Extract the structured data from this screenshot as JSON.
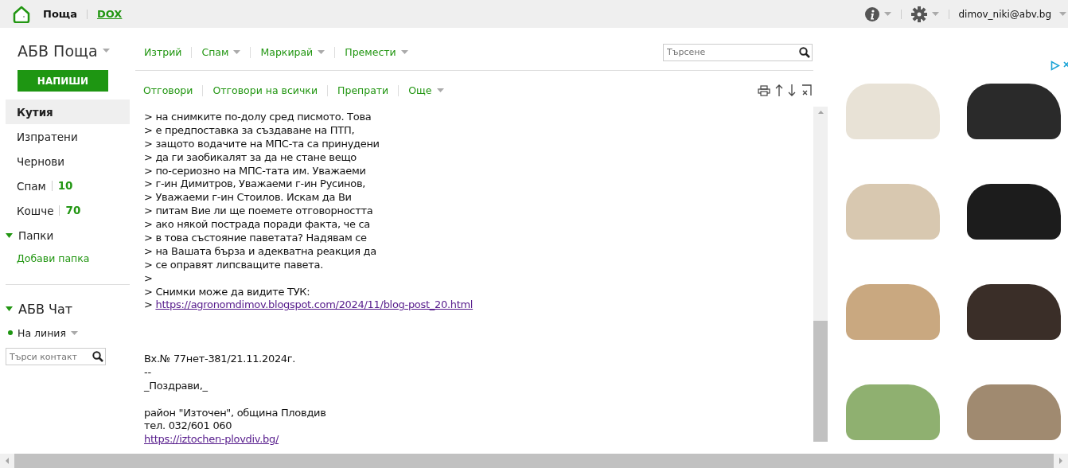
{
  "topbar": {
    "tabs": [
      {
        "label": "Поща",
        "selected": true
      },
      {
        "label": "DOX",
        "selected": false
      }
    ],
    "user": "dimov_niki@abv.bg"
  },
  "sidebar": {
    "title": "АБВ Поща",
    "compose": "НАПИШИ",
    "folders": [
      {
        "label": "Кутия",
        "selected": true
      },
      {
        "label": "Изпратени",
        "selected": false
      },
      {
        "label": "Чернови",
        "selected": false
      },
      {
        "label": "Спам",
        "count": "10",
        "selected": false
      },
      {
        "label": "Кошче",
        "count": "70",
        "selected": false
      }
    ],
    "custom_folders": {
      "label": "Папки",
      "expanded": true,
      "add": "Добави папка"
    },
    "chat": {
      "label": "АБВ Чат",
      "expanded": true,
      "status": "На линия",
      "online": true,
      "search_placeholder": "Търси контакт"
    }
  },
  "toolbar": {
    "actions": [
      {
        "label": "Изтрий",
        "dropdown": false
      },
      {
        "label": "Спам",
        "dropdown": true
      },
      {
        "label": "Маркирай",
        "dropdown": true
      },
      {
        "label": "Премести",
        "dropdown": true
      }
    ],
    "search_placeholder": "Търсене"
  },
  "message_toolbar": {
    "actions": [
      {
        "label": "Отговори",
        "dropdown": false
      },
      {
        "label": "Отговори на всички",
        "dropdown": false
      },
      {
        "label": "Препрати",
        "dropdown": false
      },
      {
        "label": "Още",
        "dropdown": true
      }
    ]
  },
  "message": {
    "lines": [
      {
        "kind": "text",
        "text": "> на снимките по-долу сред писмото. Това"
      },
      {
        "kind": "text",
        "text": "> е предпоставка за създаване на ПТП,"
      },
      {
        "kind": "text",
        "text": "> защото водачите на МПС-та са принудени"
      },
      {
        "kind": "text",
        "text": "> да ги заобикалят за да не стане вещо"
      },
      {
        "kind": "text",
        "text": "> по-сериозно на МПС-тата им. Уважаеми"
      },
      {
        "kind": "text",
        "text": "> г-ин Димитров, Уважаеми г-ин Русинов,"
      },
      {
        "kind": "text",
        "text": "> Уважаеми г-ин Стоилов. Искам да Ви"
      },
      {
        "kind": "text",
        "text": "> питам Вие ли ще поемете отговорността"
      },
      {
        "kind": "text",
        "text": "> ако някой пострада поради факта, че са"
      },
      {
        "kind": "text",
        "text": "> в това състояние паветата? Надявам се"
      },
      {
        "kind": "text",
        "text": "> на Вашата бърза и адекватна реакция да"
      },
      {
        "kind": "text",
        "text": "> се оправят липсващите павета."
      },
      {
        "kind": "text",
        "text": ">"
      },
      {
        "kind": "text",
        "text": "> Снимки може да видите ТУК:"
      },
      {
        "kind": "link",
        "prefix": "> ",
        "text": "https://agronomdimov.blogspot.com/2024/11/blog-post_20.html"
      },
      {
        "kind": "gap"
      },
      {
        "kind": "gap"
      },
      {
        "kind": "gap"
      },
      {
        "kind": "text",
        "text": "Вх.№ 77нет-381/21.11.2024г."
      },
      {
        "kind": "text",
        "text": "--"
      },
      {
        "kind": "text",
        "text": "_Поздрави,_"
      },
      {
        "kind": "gap"
      },
      {
        "kind": "text",
        "text": "район \"Източен\", община Пловдив"
      },
      {
        "kind": "text",
        "text": "тел. 032/601 060"
      },
      {
        "kind": "link",
        "text": "https://iztochen-plovdiv.bg/"
      }
    ]
  }
}
